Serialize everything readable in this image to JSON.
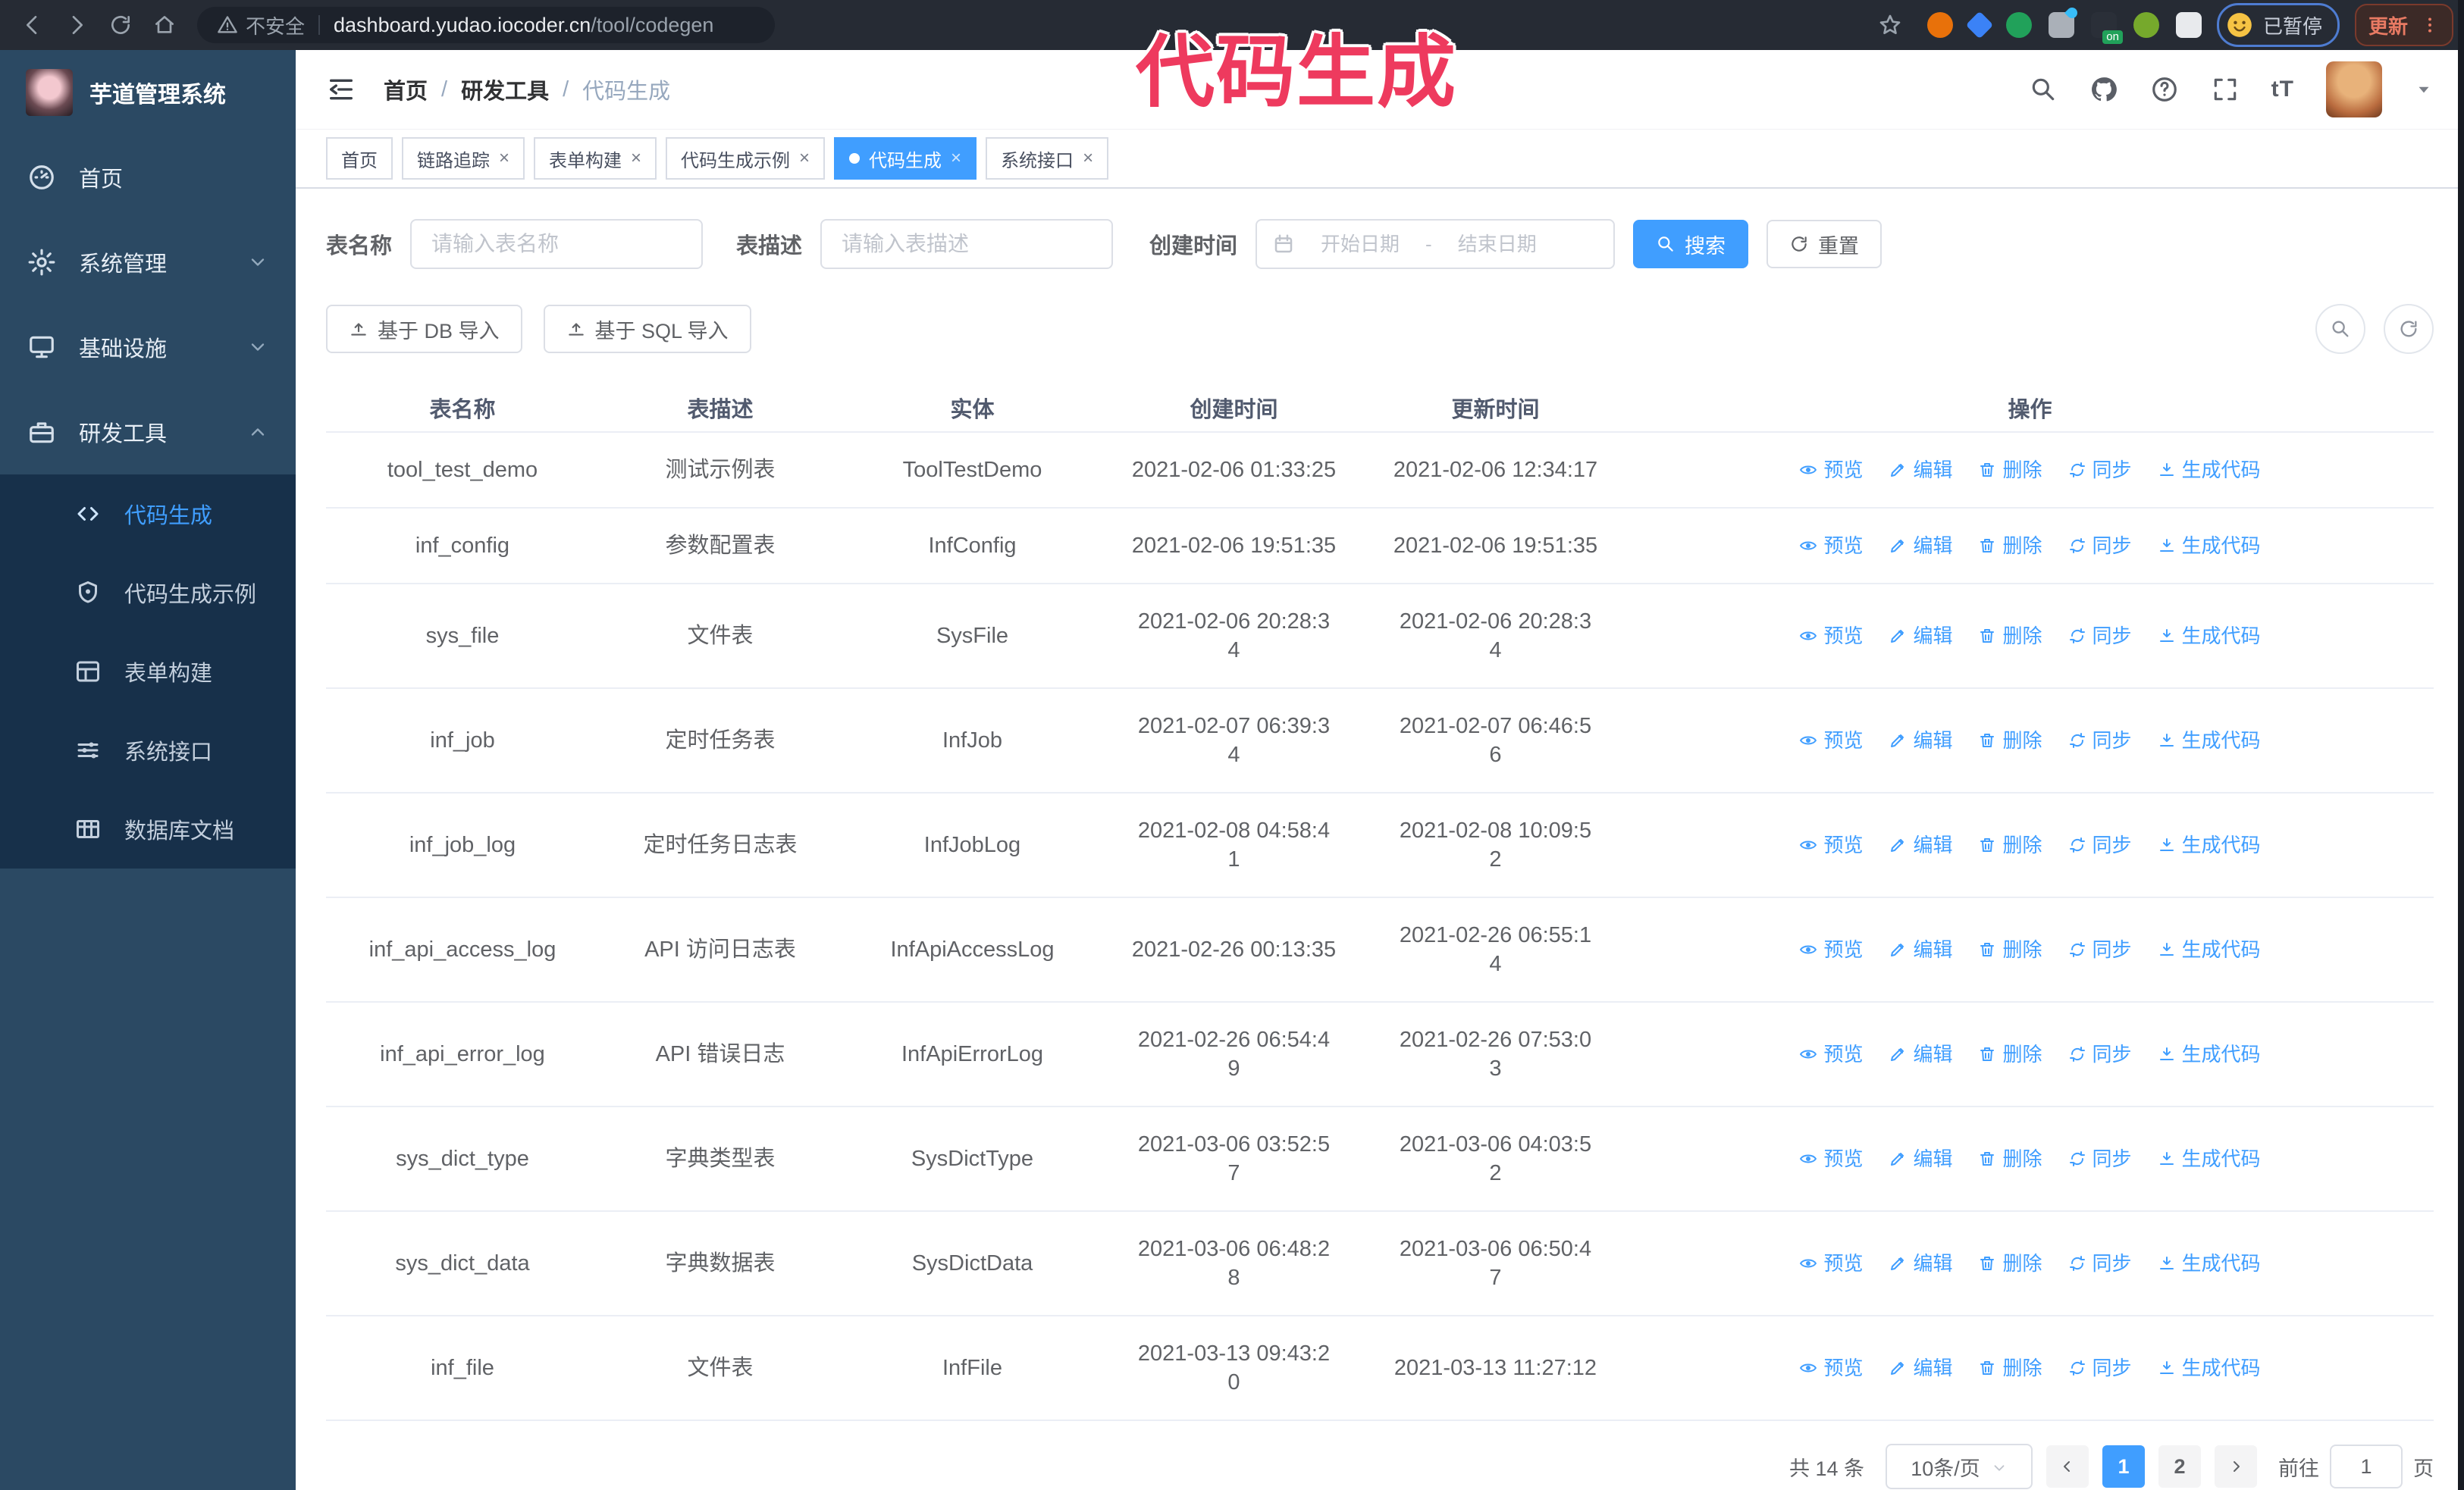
{
  "browser": {
    "not_secure": "不安全",
    "url_host": "dashboard.yudao.iocoder.cn",
    "url_path": "/tool/codegen",
    "paused_label": "已暂停",
    "update_label": "更新",
    "extensions": [
      {
        "id": "ext-orange",
        "shape": "round",
        "color": "#e8710a"
      },
      {
        "id": "ext-gem",
        "shape": "diamond",
        "color": "#3b82f6"
      },
      {
        "id": "ext-check",
        "shape": "round",
        "color": "#21a15a"
      },
      {
        "id": "ext-grid",
        "shape": "square",
        "color": "#aab0b8",
        "drop": true
      },
      {
        "id": "ext-on",
        "shape": "square",
        "color": "#2a2f38",
        "on_label": "on"
      },
      {
        "id": "ext-green-figure",
        "shape": "round",
        "color": "#76a92c"
      },
      {
        "id": "ext-puzzle",
        "shape": "square",
        "color": "#e8eaed"
      }
    ]
  },
  "annotation": {
    "text": "代码生成",
    "color": "#ee3a5e"
  },
  "sidebar": {
    "title": "芋道管理系统",
    "menu": [
      {
        "id": "home",
        "label": "首页",
        "icon": "dashboard"
      },
      {
        "id": "system",
        "label": "系统管理",
        "icon": "gear",
        "chevron": "down"
      },
      {
        "id": "infra",
        "label": "基础设施",
        "icon": "infra",
        "chevron": "down"
      },
      {
        "id": "dev-tools",
        "label": "研发工具",
        "icon": "tools",
        "chevron": "up",
        "expanded": true,
        "children": [
          {
            "id": "codegen",
            "label": "代码生成",
            "icon": "code",
            "active": true
          },
          {
            "id": "codegen-example",
            "label": "代码生成示例",
            "icon": "example"
          },
          {
            "id": "form-builder",
            "label": "表单构建",
            "icon": "form"
          },
          {
            "id": "system-api",
            "label": "系统接口",
            "icon": "api"
          },
          {
            "id": "db-doc",
            "label": "数据库文档",
            "icon": "dbdoc"
          }
        ]
      }
    ]
  },
  "header": {
    "breadcrumb": [
      "首页",
      "研发工具",
      "代码生成"
    ],
    "separator": "/",
    "font_size_label": "tT"
  },
  "tabs": [
    {
      "id": "home",
      "label": "首页",
      "closable": false,
      "active": false
    },
    {
      "id": "tracing",
      "label": "链路追踪",
      "closable": true,
      "active": false
    },
    {
      "id": "form-builder",
      "label": "表单构建",
      "closable": true,
      "active": false
    },
    {
      "id": "codegen-example",
      "label": "代码生成示例",
      "closable": true,
      "active": false
    },
    {
      "id": "codegen",
      "label": "代码生成",
      "closable": true,
      "active": true
    },
    {
      "id": "system-api",
      "label": "系统接口",
      "closable": true,
      "active": false
    }
  ],
  "filters": {
    "name_label": "表名称",
    "name_placeholder": "请输入表名称",
    "desc_label": "表描述",
    "desc_placeholder": "请输入表描述",
    "time_label": "创建时间",
    "start_placeholder": "开始日期",
    "range_separator": "-",
    "end_placeholder": "结束日期",
    "search_label": "搜索",
    "reset_label": "重置"
  },
  "toolbar": {
    "import_db_label": "基于 DB 导入",
    "import_sql_label": "基于 SQL 导入"
  },
  "table": {
    "columns": [
      "表名称",
      "表描述",
      "实体",
      "创建时间",
      "更新时间",
      "操作"
    ],
    "actions": [
      {
        "id": "preview",
        "label": "预览",
        "icon": "eye"
      },
      {
        "id": "edit",
        "label": "编辑",
        "icon": "edit"
      },
      {
        "id": "delete",
        "label": "删除",
        "icon": "delete"
      },
      {
        "id": "sync",
        "label": "同步",
        "icon": "sync"
      },
      {
        "id": "generate",
        "label": "生成代码",
        "icon": "download"
      }
    ],
    "rows": [
      {
        "name": "tool_test_demo",
        "desc": "测试示例表",
        "entity": "ToolTestDemo",
        "created": [
          "2021-02-06 01:33:25"
        ],
        "updated": [
          "2021-02-06 12:34:17"
        ]
      },
      {
        "name": "inf_config",
        "desc": "参数配置表",
        "entity": "InfConfig",
        "created": [
          "2021-02-06 19:51:35"
        ],
        "updated": [
          "2021-02-06 19:51:35"
        ]
      },
      {
        "name": "sys_file",
        "desc": "文件表",
        "entity": "SysFile",
        "created": [
          "2021-02-06 20:28:3",
          "4"
        ],
        "updated": [
          "2021-02-06 20:28:3",
          "4"
        ]
      },
      {
        "name": "inf_job",
        "desc": "定时任务表",
        "entity": "InfJob",
        "created": [
          "2021-02-07 06:39:3",
          "4"
        ],
        "updated": [
          "2021-02-07 06:46:5",
          "6"
        ]
      },
      {
        "name": "inf_job_log",
        "desc": "定时任务日志表",
        "entity": "InfJobLog",
        "created": [
          "2021-02-08 04:58:4",
          "1"
        ],
        "updated": [
          "2021-02-08 10:09:5",
          "2"
        ]
      },
      {
        "name": "inf_api_access_log",
        "desc": "API 访问日志表",
        "entity": "InfApiAccessLog",
        "created": [
          "2021-02-26 00:13:35"
        ],
        "updated": [
          "2021-02-26 06:55:1",
          "4"
        ]
      },
      {
        "name": "inf_api_error_log",
        "desc": "API 错误日志",
        "entity": "InfApiErrorLog",
        "created": [
          "2021-02-26 06:54:4",
          "9"
        ],
        "updated": [
          "2021-02-26 07:53:0",
          "3"
        ]
      },
      {
        "name": "sys_dict_type",
        "desc": "字典类型表",
        "entity": "SysDictType",
        "created": [
          "2021-03-06 03:52:5",
          "7"
        ],
        "updated": [
          "2021-03-06 04:03:5",
          "2"
        ]
      },
      {
        "name": "sys_dict_data",
        "desc": "字典数据表",
        "entity": "SysDictData",
        "created": [
          "2021-03-06 06:48:2",
          "8"
        ],
        "updated": [
          "2021-03-06 06:50:4",
          "7"
        ]
      },
      {
        "name": "inf_file",
        "desc": "文件表",
        "entity": "InfFile",
        "created": [
          "2021-03-13 09:43:2",
          "0"
        ],
        "updated": [
          "2021-03-13 11:27:12"
        ]
      }
    ]
  },
  "pagination": {
    "total_label": "共 14 条",
    "page_size_label": "10条/页",
    "pages": [
      {
        "label": "1",
        "active": true
      },
      {
        "label": "2",
        "active": false
      }
    ],
    "goto_label": "前往",
    "goto_value": "1",
    "goto_suffix": "页"
  },
  "colors": {
    "primary": "#409EFF",
    "sidebar_bg": "#2b4963",
    "submenu_bg": "#17304a",
    "annotation": "#ee3a5e"
  }
}
